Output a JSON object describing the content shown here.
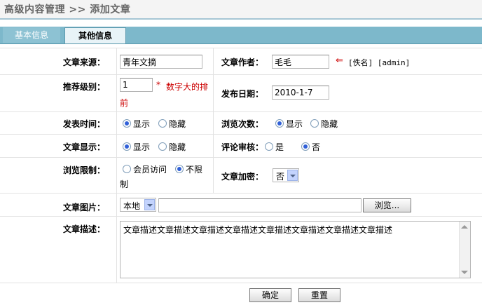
{
  "header": {
    "title": "高级内容管理 >> 添加文章"
  },
  "tabs": [
    {
      "label": "基本信息",
      "active": false
    },
    {
      "label": "其他信息",
      "active": true
    }
  ],
  "form": {
    "source": {
      "label": "文章来源：",
      "value": "青年文摘"
    },
    "author": {
      "label": "文章作者：",
      "value": "毛毛",
      "arrow": "⇐",
      "hint": "[佚名] [admin]"
    },
    "level": {
      "label": "推荐级别：",
      "value": "1",
      "note_star": "*",
      "note_line1": "数字大的排",
      "note_line2": "前"
    },
    "date": {
      "label": "发布日期：",
      "value": "2010-1-7"
    },
    "publish_time": {
      "label": "发表时间：",
      "options": [
        "显示",
        "隐藏"
      ],
      "selected": "显示"
    },
    "view_count": {
      "label": "浏览次数：",
      "options": [
        "显示",
        "隐藏"
      ],
      "selected": "显示"
    },
    "display": {
      "label": "文章显示：",
      "options": [
        "显示",
        "隐藏"
      ],
      "selected": "显示"
    },
    "review": {
      "label": "评论审核：",
      "options": [
        "是",
        "否"
      ],
      "selected": "否"
    },
    "restrict": {
      "label": "浏览限制：",
      "option1": "会员访问",
      "option2a": "不限",
      "option2b": "制",
      "selected": "不限制"
    },
    "encrypt": {
      "label": "文章加密：",
      "value": "否"
    },
    "image": {
      "label": "文章图片：",
      "select_value": "本地",
      "path_value": "",
      "browse_label": "浏览..."
    },
    "description": {
      "label": "文章描述：",
      "value": "文章描述文章描述文章描述文章描述文章描述文章描述文章描述文章描述"
    }
  },
  "buttons": {
    "confirm": "确定",
    "reset": "重置"
  },
  "colors": {
    "tabbar": "#7db8cb",
    "radio_dot": "#3060d8",
    "hint_red": "#cc0000"
  }
}
